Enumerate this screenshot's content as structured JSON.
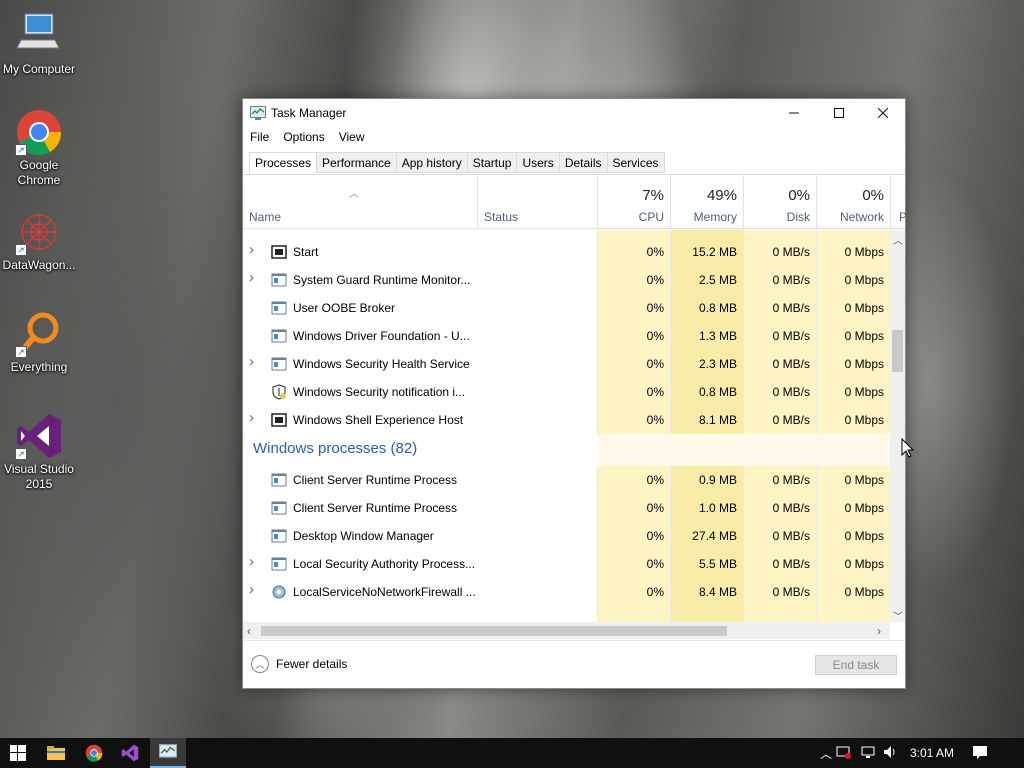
{
  "desktop": {
    "icons": [
      {
        "label": "My Computer",
        "icon": "computer-icon"
      },
      {
        "label": "Google Chrome",
        "icon": "chrome-icon"
      },
      {
        "label": "DataWagon...",
        "icon": "datawagon-icon"
      },
      {
        "label": "Everything",
        "icon": "everything-search-icon"
      },
      {
        "label": "Visual Studio 2015",
        "icon": "visual-studio-icon"
      }
    ]
  },
  "window": {
    "title": "Task Manager",
    "menu": [
      "File",
      "Options",
      "View"
    ],
    "tabs": [
      "Processes",
      "Performance",
      "App history",
      "Startup",
      "Users",
      "Details",
      "Services"
    ],
    "active_tab": "Processes",
    "header": {
      "name": "Name",
      "status": "Status",
      "cpu": {
        "pct": "7%",
        "label": "CPU"
      },
      "memory": {
        "pct": "49%",
        "label": "Memory"
      },
      "disk": {
        "pct": "0%",
        "label": "Disk"
      },
      "network": {
        "pct": "0%",
        "label": "Network"
      },
      "next": "P"
    },
    "rows": [
      {
        "type": "proc",
        "expander": true,
        "icon": "start-icon",
        "name": "Start",
        "cpu": "0%",
        "memory": "15.2 MB",
        "disk": "0 MB/s",
        "network": "0 Mbps"
      },
      {
        "type": "proc",
        "expander": true,
        "icon": "app-window-icon",
        "name": "System Guard Runtime Monitor...",
        "cpu": "0%",
        "memory": "2.5 MB",
        "disk": "0 MB/s",
        "network": "0 Mbps"
      },
      {
        "type": "proc",
        "expander": false,
        "icon": "app-window-icon",
        "name": "User OOBE Broker",
        "cpu": "0%",
        "memory": "0.8 MB",
        "disk": "0 MB/s",
        "network": "0 Mbps"
      },
      {
        "type": "proc",
        "expander": false,
        "icon": "app-window-icon",
        "name": "Windows Driver Foundation - U...",
        "cpu": "0%",
        "memory": "1.3 MB",
        "disk": "0 MB/s",
        "network": "0 Mbps"
      },
      {
        "type": "proc",
        "expander": true,
        "icon": "app-window-icon",
        "name": "Windows Security Health Service",
        "cpu": "0%",
        "memory": "2.3 MB",
        "disk": "0 MB/s",
        "network": "0 Mbps"
      },
      {
        "type": "proc",
        "expander": false,
        "icon": "shield-icon",
        "name": "Windows Security notification i...",
        "cpu": "0%",
        "memory": "0.8 MB",
        "disk": "0 MB/s",
        "network": "0 Mbps"
      },
      {
        "type": "proc",
        "expander": true,
        "icon": "start-icon",
        "name": "Windows Shell Experience Host",
        "cpu": "0%",
        "memory": "8.1 MB",
        "disk": "0 MB/s",
        "network": "0 Mbps"
      },
      {
        "type": "group",
        "name": "Windows processes (82)"
      },
      {
        "type": "proc",
        "expander": false,
        "icon": "app-window-icon",
        "name": "Client Server Runtime Process",
        "cpu": "0%",
        "memory": "0.9 MB",
        "disk": "0 MB/s",
        "network": "0 Mbps"
      },
      {
        "type": "proc",
        "expander": false,
        "icon": "app-window-icon",
        "name": "Client Server Runtime Process",
        "cpu": "0%",
        "memory": "1.0 MB",
        "disk": "0 MB/s",
        "network": "0 Mbps"
      },
      {
        "type": "proc",
        "expander": false,
        "icon": "app-window-icon",
        "name": "Desktop Window Manager",
        "cpu": "0%",
        "memory": "27.4 MB",
        "disk": "0 MB/s",
        "network": "0 Mbps"
      },
      {
        "type": "proc",
        "expander": true,
        "icon": "app-window-icon",
        "name": "Local Security Authority Process...",
        "cpu": "0%",
        "memory": "5.5 MB",
        "disk": "0 MB/s",
        "network": "0 Mbps"
      },
      {
        "type": "proc",
        "expander": true,
        "icon": "gear-icon",
        "name": "LocalServiceNoNetworkFirewall ...",
        "cpu": "0%",
        "memory": "8.4 MB",
        "disk": "0 MB/s",
        "network": "0 Mbps"
      }
    ],
    "footer": {
      "fewer_details": "Fewer details",
      "end_task": "End task"
    }
  },
  "taskbar": {
    "items": [
      "windows-start-icon",
      "file-explorer-icon",
      "chrome-icon",
      "visual-studio-icon",
      "task-manager-icon"
    ],
    "clock": "3:01 AM"
  },
  "colors": {
    "cpu_col": "#fff4c4",
    "memory_col": "#f9eca8",
    "other_col": "#fff4c4",
    "group_text": "#2b5fa6",
    "header_label": "#4c607a"
  }
}
